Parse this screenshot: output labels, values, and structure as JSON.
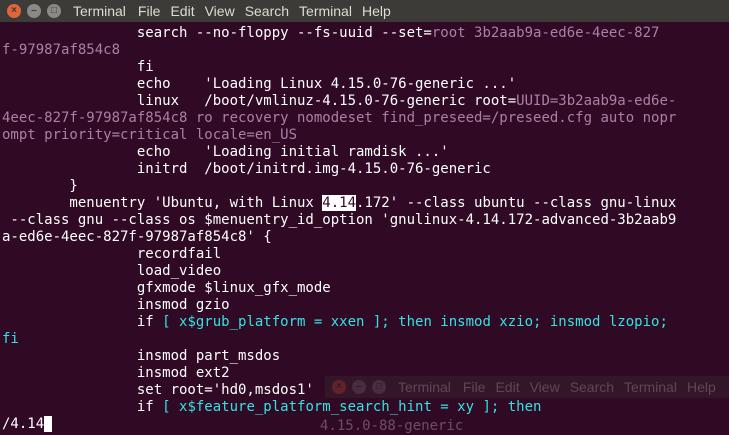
{
  "window": {
    "title": "Terminal",
    "menu": [
      "File",
      "Edit",
      "View",
      "Search",
      "Terminal",
      "Help"
    ]
  },
  "terminal": {
    "lines": [
      [
        {
          "t": "                search --no-floppy --fs-uuid --set="
        },
        {
          "t": "root 3b2aab9a-ed6e-4eec-827",
          "s": "p"
        }
      ],
      [
        {
          "t": "f-97987af854c8",
          "s": "p"
        }
      ],
      [
        {
          "t": "                fi"
        }
      ],
      [
        {
          "t": "                echo    'Loading Linux 4.15.0-76-generic ...'"
        }
      ],
      [
        {
          "t": "                linux   /boot/vmlinuz-4.15.0-76-generic root="
        },
        {
          "t": "UUID=3b2aab9a-ed6e-",
          "s": "p"
        }
      ],
      [
        {
          "t": "4eec-827f-97987af854c8 ro recovery nomodeset find_preseed=/preseed.cfg auto nopr",
          "s": "p"
        }
      ],
      [
        {
          "t": "ompt priority=critical locale=en_US",
          "s": "p"
        }
      ],
      [
        {
          "t": "                echo    'Loading initial ramdisk ...'"
        }
      ],
      [
        {
          "t": "                initrd  /boot/initrd.img-4.15.0-76-generic"
        }
      ],
      [
        {
          "t": "        }"
        }
      ],
      [
        {
          "t": "        menuentry 'Ubuntu, with Linux "
        },
        {
          "t": "4.14",
          "s": "hl"
        },
        {
          "t": ".172' --class ubuntu --class gnu-linux"
        }
      ],
      [
        {
          "t": " --class gnu --class os $menuentry_id_option 'gnulinux-4.14.172-advanced-3b2aab9"
        }
      ],
      [
        {
          "t": "a-ed6e-4eec-827f-97987af854c8' {"
        }
      ],
      [
        {
          "t": "                recordfail"
        }
      ],
      [
        {
          "t": "                load_video"
        }
      ],
      [
        {
          "t": "                gfxmode $linux_gfx_mode"
        }
      ],
      [
        {
          "t": "                insmod gzio"
        }
      ],
      [
        {
          "t": "                if "
        },
        {
          "t": "[ x$grub_platform = xxen ]; then insmod xzio; insmod lzopio;",
          "s": "c"
        }
      ],
      [
        {
          "t": "fi",
          "s": "c"
        }
      ],
      [
        {
          "t": "                insmod part_msdos"
        }
      ],
      [
        {
          "t": "                insmod ext2"
        }
      ],
      [
        {
          "t": "                set root='hd0,msdos1'"
        }
      ],
      [
        {
          "t": "                if "
        },
        {
          "t": "[ x$feature_platform_search_hint = xy ]; then",
          "s": "c"
        }
      ]
    ],
    "prompt": "/4.14"
  },
  "ghost_window": {
    "title": "Terminal",
    "menu": [
      "File",
      "Edit",
      "View",
      "Search",
      "Terminal",
      "Help"
    ],
    "text": "4.15.0-88-generic"
  }
}
